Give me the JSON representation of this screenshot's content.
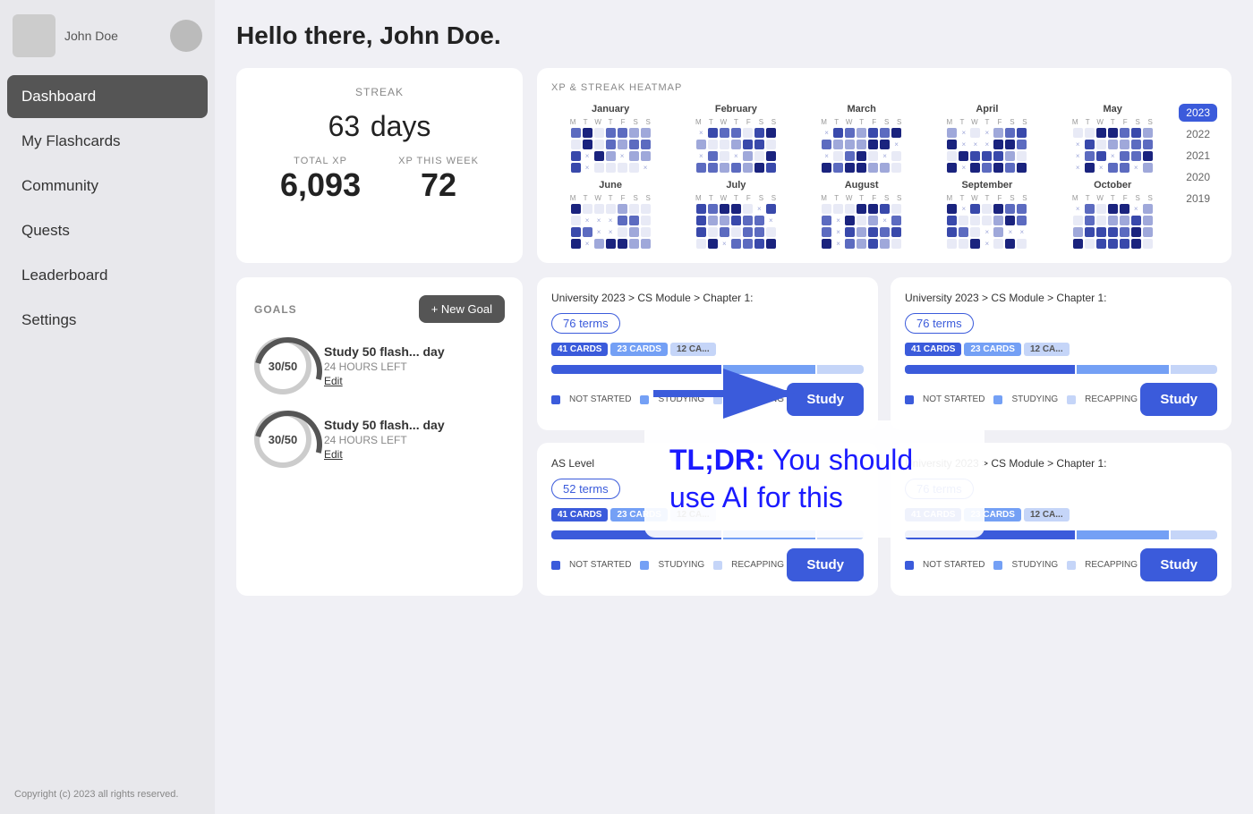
{
  "sidebar": {
    "username": "John Doe",
    "copyright": "Copyright (c) 2023 all rights reserved.",
    "items": [
      {
        "label": "Dashboard",
        "active": true
      },
      {
        "label": "My Flashcards",
        "active": false
      },
      {
        "label": "Community",
        "active": false
      },
      {
        "label": "Quests",
        "active": false
      },
      {
        "label": "Leaderboard",
        "active": false
      },
      {
        "label": "Settings",
        "active": false
      }
    ]
  },
  "header": {
    "greeting": "Hello there, John Doe."
  },
  "streak": {
    "label": "STREAK",
    "value": "63",
    "unit": "days",
    "total_xp_label": "TOTAL XP",
    "total_xp_value": "6,093",
    "xp_week_label": "XP THIS WEEK",
    "xp_week_value": "72"
  },
  "heatmap": {
    "title": "XP & STREAK HEATMAP",
    "months": [
      "January",
      "February",
      "March",
      "April",
      "May",
      "June",
      "July",
      "August",
      "September",
      "October"
    ],
    "years": [
      "2023",
      "2022",
      "2021",
      "2020",
      "2019"
    ]
  },
  "goals": {
    "title": "GOALS",
    "new_goal_label": "+ New Goal",
    "items": [
      {
        "progress": "30/50",
        "name": "Study 50 flash... day",
        "time": "24 HOURS LEFT",
        "edit": "Edit"
      },
      {
        "progress": "30/50",
        "name": "Study 50 flash... day",
        "time": "24 HOURS LEFT",
        "edit": "Edit"
      }
    ]
  },
  "flashcards": [
    {
      "breadcrumb": "University 2023 > CS Module > Chapter 1:",
      "terms": "76 terms",
      "cards_not_started": "41 CARDS",
      "cards_studying": "23 CARDS",
      "cards_recapping": "12 CA...",
      "legend_ns": "NOT STARTED",
      "legend_st": "STUDYING",
      "legend_rc": "RECAPPING",
      "study_label": "Study",
      "bar_ns": 55,
      "bar_st": 30,
      "bar_rc": 15
    },
    {
      "breadcrumb": "University 2023 > CS Module > Chapter 1:",
      "terms": "76 terms",
      "cards_not_started": "41 CARDS",
      "cards_studying": "23 CARDS",
      "cards_recapping": "12 CA...",
      "legend_ns": "NOT STARTED",
      "legend_st": "STUDYING",
      "legend_rc": "RECAPPING",
      "study_label": "Study",
      "bar_ns": 55,
      "bar_st": 30,
      "bar_rc": 15
    },
    {
      "breadcrumb": "AS Level",
      "terms": "52 terms",
      "cards_not_started": "41 CARDS",
      "cards_studying": "23 CARDS",
      "cards_recapping": "12 CA...",
      "legend_ns": "NOT STARTED",
      "legend_st": "STUDYING",
      "legend_rc": "RECAPPING",
      "study_label": "Study",
      "bar_ns": 55,
      "bar_st": 30,
      "bar_rc": 15
    },
    {
      "breadcrumb": "University 2023 > CS Module > Chapter 1:",
      "terms": "76 terms",
      "cards_not_started": "41 CARDS",
      "cards_studying": "23 CARDS",
      "cards_recapping": "12 CA...",
      "legend_ns": "NOT STARTED",
      "legend_st": "STUDYING",
      "legend_rc": "RECAPPING",
      "study_label": "Study",
      "bar_ns": 55,
      "bar_st": 30,
      "bar_rc": 15
    }
  ],
  "overlay": {
    "tldr_prefix": "TL;DR:",
    "tldr_text": " You should use AI for this"
  }
}
